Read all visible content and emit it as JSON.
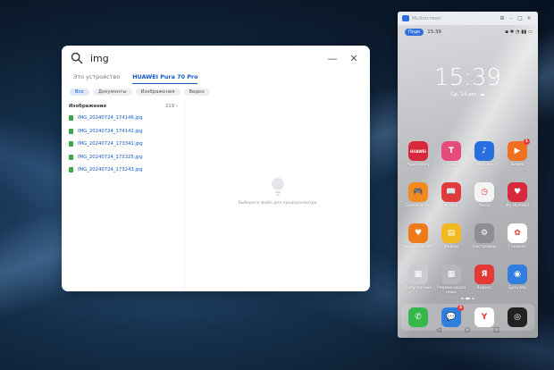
{
  "search_window": {
    "query": "img",
    "tabs": [
      {
        "label": "Это устройство",
        "active": false
      },
      {
        "label": "HUAWEI Pura 70 Pro",
        "active": true
      }
    ],
    "chips": [
      {
        "label": "Все",
        "active": true
      },
      {
        "label": "Документы",
        "active": false
      },
      {
        "label": "Изображения",
        "active": false
      },
      {
        "label": "Видео",
        "active": false
      }
    ],
    "section_title": "Изображения",
    "section_count": "219",
    "files": [
      "IMG_20240724_174146.jpg",
      "IMG_20240724_174142.jpg",
      "IMG_20240724_173341.jpg",
      "IMG_20240724_173325.jpg",
      "IMG_20240724_173243.jpg"
    ],
    "preview_hint": "Выберите файл для предпросмотра"
  },
  "phone_window": {
    "title": "Multiscreen",
    "status": {
      "connect_label": "Подк",
      "time": "15:39"
    },
    "clock": "15:39",
    "date": "Ср, 14 авг.",
    "apps": [
      {
        "label": "AppGallery",
        "color": "#d9283c",
        "glyph": "HUAWEI",
        "badge": ""
      },
      {
        "label": "Темы",
        "color": "#e44b7a",
        "glyph": "T",
        "badge": ""
      },
      {
        "label": "Музыка",
        "color": "#2a6fe0",
        "glyph": "♪",
        "badge": ""
      },
      {
        "label": "Видео",
        "color": "#f07020",
        "glyph": "▶",
        "badge": "1"
      },
      {
        "label": "GameCenter",
        "color": "#f28a1d",
        "glyph": "🎮",
        "badge": ""
      },
      {
        "label": "Книги",
        "color": "#e03c3c",
        "glyph": "📖",
        "badge": ""
      },
      {
        "label": "Часы",
        "color": "#f4f4f4",
        "glyph": "◷",
        "badge": ""
      },
      {
        "label": "Мy HUAWEI",
        "color": "#d9283c",
        "glyph": "♥",
        "badge": ""
      },
      {
        "label": "Huawei Health",
        "color": "#f07a1a",
        "glyph": "♥",
        "badge": ""
      },
      {
        "label": "Файлы",
        "color": "#f2b822",
        "glyph": "▤",
        "badge": ""
      },
      {
        "label": "Настройки",
        "color": "#8d8f94",
        "glyph": "⚙",
        "badge": ""
      },
      {
        "label": "Галерея",
        "color": "#ffffff",
        "glyph": "✿",
        "badge": ""
      },
      {
        "label": "Популярные",
        "color": "#c9cbd0",
        "glyph": "▦",
        "badge": ""
      },
      {
        "label": "Рекомендова нные",
        "color": "#b5b7bc",
        "glyph": "▦",
        "badge": ""
      },
      {
        "label": "Яндекс",
        "color": "#e53935",
        "glyph": "Я",
        "badge": ""
      },
      {
        "label": "Браузер",
        "color": "#2f7ee0",
        "glyph": "◉",
        "badge": ""
      }
    ],
    "dock": [
      {
        "label": "Телефон",
        "color": "#35b84a",
        "glyph": "✆",
        "badge": ""
      },
      {
        "label": "Сообщения",
        "color": "#2f7ee0",
        "glyph": "💬",
        "badge": "3"
      },
      {
        "label": "Яндекс Браузер",
        "color": "#ffffff",
        "glyph": "Y",
        "badge": ""
      },
      {
        "label": "Камера",
        "color": "#222222",
        "glyph": "◎",
        "badge": ""
      }
    ]
  }
}
